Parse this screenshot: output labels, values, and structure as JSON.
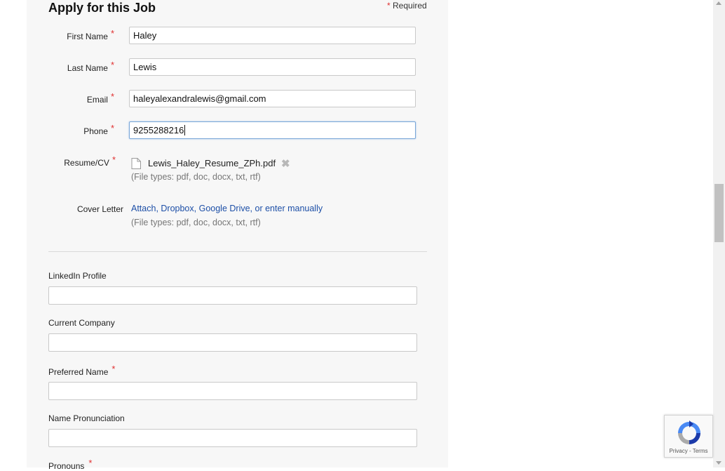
{
  "form": {
    "title": "Apply for this Job",
    "required_star": "*",
    "required_label": "Required",
    "fields": {
      "first_name": {
        "label": "First Name",
        "value": "Haley"
      },
      "last_name": {
        "label": "Last Name",
        "value": "Lewis"
      },
      "email": {
        "label": "Email",
        "value": "haleyalexandralewis@gmail.com"
      },
      "phone": {
        "label": "Phone",
        "value": "9255288216"
      }
    },
    "resume": {
      "label": "Resume/CV",
      "file_name": "Lewis_Haley_Resume_ZPh.pdf",
      "file_types": "(File types: pdf, doc, docx, txt, rtf)"
    },
    "cover_letter": {
      "label": "Cover Letter",
      "attach": "Attach",
      "dropbox": "Dropbox",
      "google_drive": "Google Drive",
      "or": "or",
      "enter_manually": "enter manually",
      "file_types": "(File types: pdf, doc, docx, txt, rtf)"
    },
    "extra": {
      "linkedin": {
        "label": "LinkedIn Profile",
        "value": ""
      },
      "current_company": {
        "label": "Current Company",
        "value": ""
      },
      "preferred_name": {
        "label": "Preferred Name",
        "value": ""
      },
      "name_pronunciation": {
        "label": "Name Pronunciation",
        "value": ""
      },
      "pronouns": {
        "label": "Pronouns"
      }
    }
  },
  "recaptcha": {
    "privacy": "Privacy",
    "separator": "-",
    "terms": "Terms",
    "icon": "recaptcha-logo"
  },
  "colors": {
    "required_star": "#e03131",
    "link": "#1d4fa7",
    "focus_border": "#7aa7d8"
  }
}
